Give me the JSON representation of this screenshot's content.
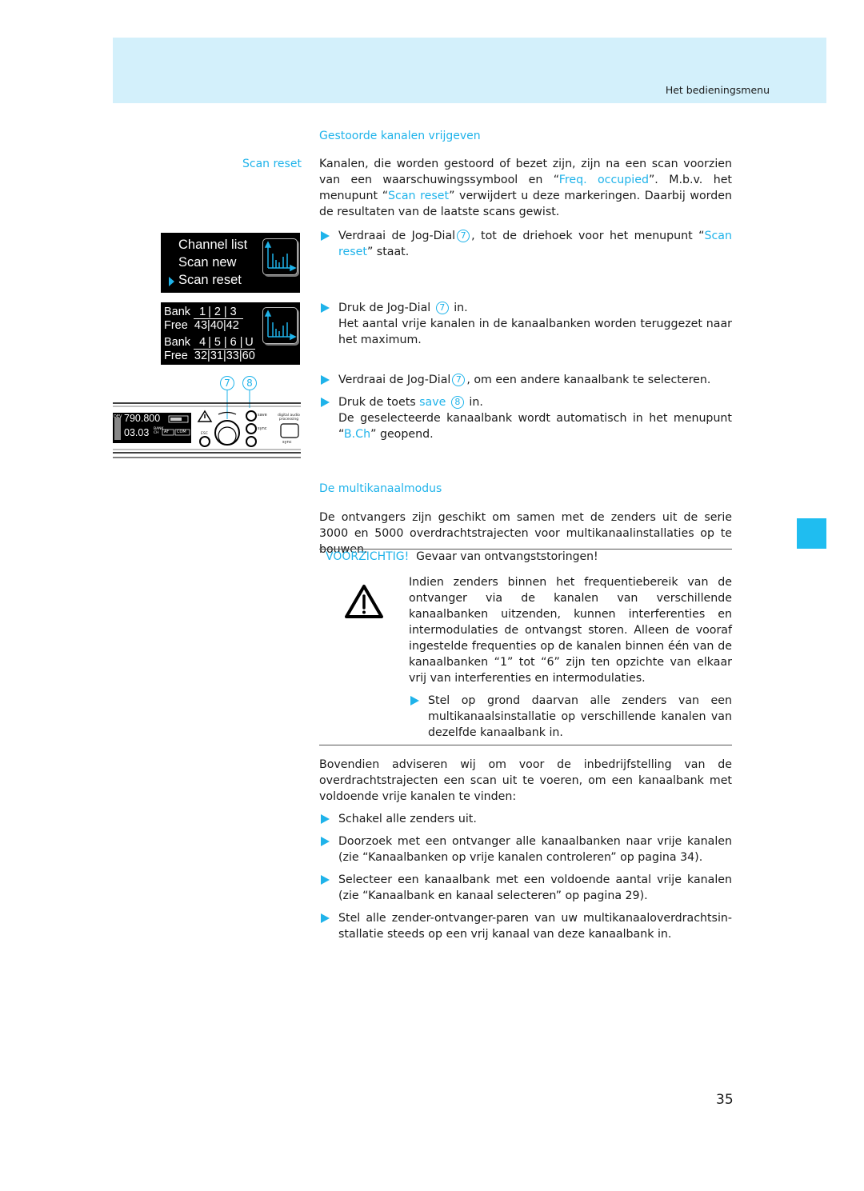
{
  "header": {
    "section_title": "Het bedieningsmenu"
  },
  "side_label": "Scan reset",
  "section1": {
    "heading": "Gestoorde kanalen vrijgeven",
    "intro": {
      "p1": "Kanalen, die worden gestoord of bezet zijn, zijn na een scan voorzien van een waarschuwingssymbool en “",
      "hl1": "Freq. occupied",
      "p2": "”. M.b.v. het menupunt “",
      "hl2": "Scan reset",
      "p3": "” verwijdert u deze markeringen. Daarbij worden de resultaten van de laatste scans gewist."
    },
    "steps": [
      {
        "a": "Verdraai de Jog-Dial",
        "num": "7",
        "b": ", tot de driehoek voor het menupunt “",
        "hl": "Scan reset",
        "c": "” staat."
      },
      {
        "a": "Druk de Jog-Dial",
        "num": "7",
        "b": " in.",
        "result": "Het aantal vrije kanalen in de kanaalbanken worden teruggezet naar het maximum."
      },
      {
        "a": "Verdraai de Jog-Dial",
        "num": "7",
        "b": ", om een andere kanaalbank te selecteren."
      },
      {
        "a": "Druk de toets ",
        "hl": "save",
        "num": "8",
        "b": " in.",
        "result_a": "De geselecteerde kanaalbank wordt automatisch in het menupunt “",
        "result_hl": "B.Ch",
        "result_b": "” geopend."
      }
    ]
  },
  "lcd_menu": {
    "items": [
      "Channel list",
      "Scan new",
      "Scan reset"
    ],
    "selected_index": 2
  },
  "lcd_banks": {
    "bank_label": "Bank",
    "free_label": "Free",
    "row1": {
      "banks": [
        "1",
        "2",
        "3"
      ],
      "free": [
        "43",
        "40",
        "42"
      ]
    },
    "row2": {
      "banks": [
        "4",
        "5",
        "6",
        "U"
      ],
      "free": [
        "32",
        "31",
        "33",
        "60"
      ]
    }
  },
  "device": {
    "callouts": [
      "7",
      "8"
    ],
    "freq": "790.800",
    "bank_ch": "03.03",
    "bank_label": "BANK",
    "ch_label": "CH",
    "af": "AF",
    "com": "COM",
    "dev": "DEV",
    "esc": "ESC",
    "save": "save",
    "sync": "sync",
    "dap": "digital audio processing",
    "sync2": "sync"
  },
  "section2": {
    "heading": "De multikanaalmodus",
    "intro": "De ontvangers zijn geschikt om samen met de zenders uit de serie 3000 en 5000 overdrachtstrajecten voor multikanaalinstallaties op te bouwen.",
    "warning": {
      "label": "VOORZICHTIG!",
      "title": "Gevaar van ontvangststoringen!",
      "body": "Indien zenders binnen het frequentiebereik van de ontvanger via de kanalen van verschillende kanaalbanken uitzenden, kunnen interferenties en intermodulaties de ontvangst storen. Alleen de vooraf ingestelde frequenties op de kanalen binnen één van de kanaalbanken “1” tot “6” zijn ten opzichte van elkaar vrij van interferenties en intermodulaties.",
      "step": "Stel op grond daarvan alle zenders van een multikanaalsinstallatie op verschillende kanalen van dezelfde kanaalbank in."
    },
    "para2": "Bovendien adviseren wij om voor de inbedrijfstelling van de overdrachtstrajecten een scan uit te voeren, om een kanaalbank met voldoende vrije kanalen te vinden:",
    "steps": [
      "Schakel alle zenders uit.",
      "Doorzoek met een ontvanger alle kanaalbanken naar vrije kanalen (zie “Kanaalbanken op vrije kanalen controleren” op pagina 34).",
      "Selecteer een kanaalbank met een voldoende aantal vrije kanalen (zie “Kanaalbank en kanaal selecteren” op pagina 29).",
      "Stel alle zender-ontvanger-paren van uw multikanaaloverdrachtsin-stallatie steeds op een vrij kanaal van deze kanaalbank in."
    ]
  },
  "page_number": "35",
  "colors": {
    "accent": "#1fb3ea",
    "header_band": "#d3f0fb",
    "side_tab": "#1fbdf0"
  }
}
